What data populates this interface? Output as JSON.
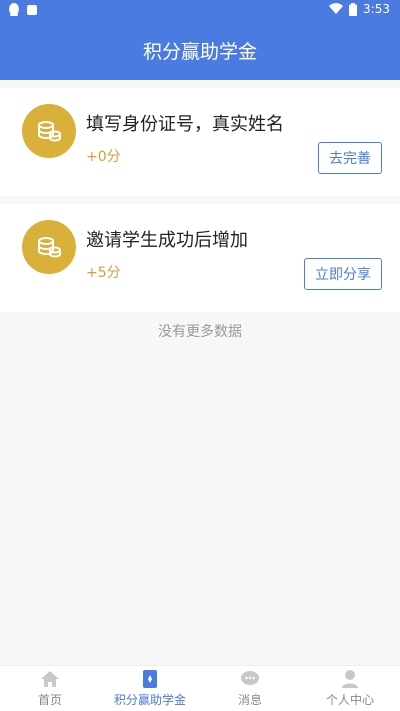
{
  "status_bar": {
    "time": "3:53"
  },
  "header": {
    "title": "积分赢助学金"
  },
  "tasks": [
    {
      "title": "填写身份证号，真实姓名",
      "points": "+0分",
      "button": "去完善"
    },
    {
      "title": "邀请学生成功后增加",
      "points": "+5分",
      "button": "立即分享"
    }
  ],
  "empty_text": "没有更多数据",
  "tabs": [
    {
      "label": "首页",
      "icon": "home-icon"
    },
    {
      "label": "积分赢助学金",
      "icon": "scholarship-icon",
      "active": true
    },
    {
      "label": "消息",
      "icon": "message-icon"
    },
    {
      "label": "个人中心",
      "icon": "profile-icon"
    }
  ],
  "colors": {
    "primary": "#4a7be0",
    "coin": "#d9b13a",
    "points": "#d2a23a"
  }
}
